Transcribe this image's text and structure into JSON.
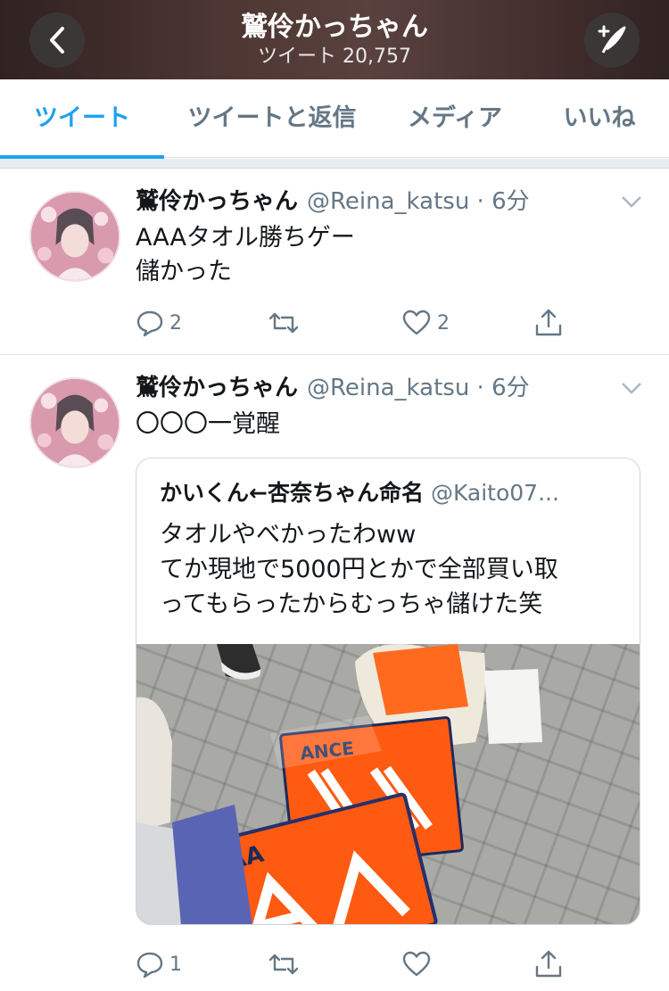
{
  "header": {
    "title": "鷲伶かっちゃん",
    "subtitle": "ツイート 20,757"
  },
  "tabs": [
    {
      "label": "ツイート",
      "active": true
    },
    {
      "label": "ツイートと返信",
      "active": false
    },
    {
      "label": "メディア",
      "active": false
    },
    {
      "label": "いいね",
      "active": false
    }
  ],
  "colors": {
    "accent": "#1da1f2",
    "muted": "#657786"
  },
  "tweets": [
    {
      "name": "鷲伶かっちゃん",
      "meta": "@Reina_katsu · 6分",
      "text": "AAAタオル勝ちゲー\n儲かった",
      "reply_count": "2",
      "retweet_count": "",
      "like_count": "2"
    },
    {
      "name": "鷲伶かっちゃん",
      "meta": "@Reina_katsu · 6分",
      "text": "〇〇〇一覚醒",
      "reply_count": "1",
      "retweet_count": "",
      "like_count": "",
      "quote": {
        "name": "かいくん←杏奈ちゃん命名",
        "handle": "@Kaito07...",
        "text": "タオルやべかったわww\nてか現地で5000円とかで全部買い取\nってもらったからむっちゃ儲けた笑"
      }
    }
  ],
  "icons": [
    "back-arrow-icon",
    "compose-icon",
    "chevron-down-icon",
    "reply-icon",
    "retweet-icon",
    "like-icon",
    "share-icon"
  ]
}
